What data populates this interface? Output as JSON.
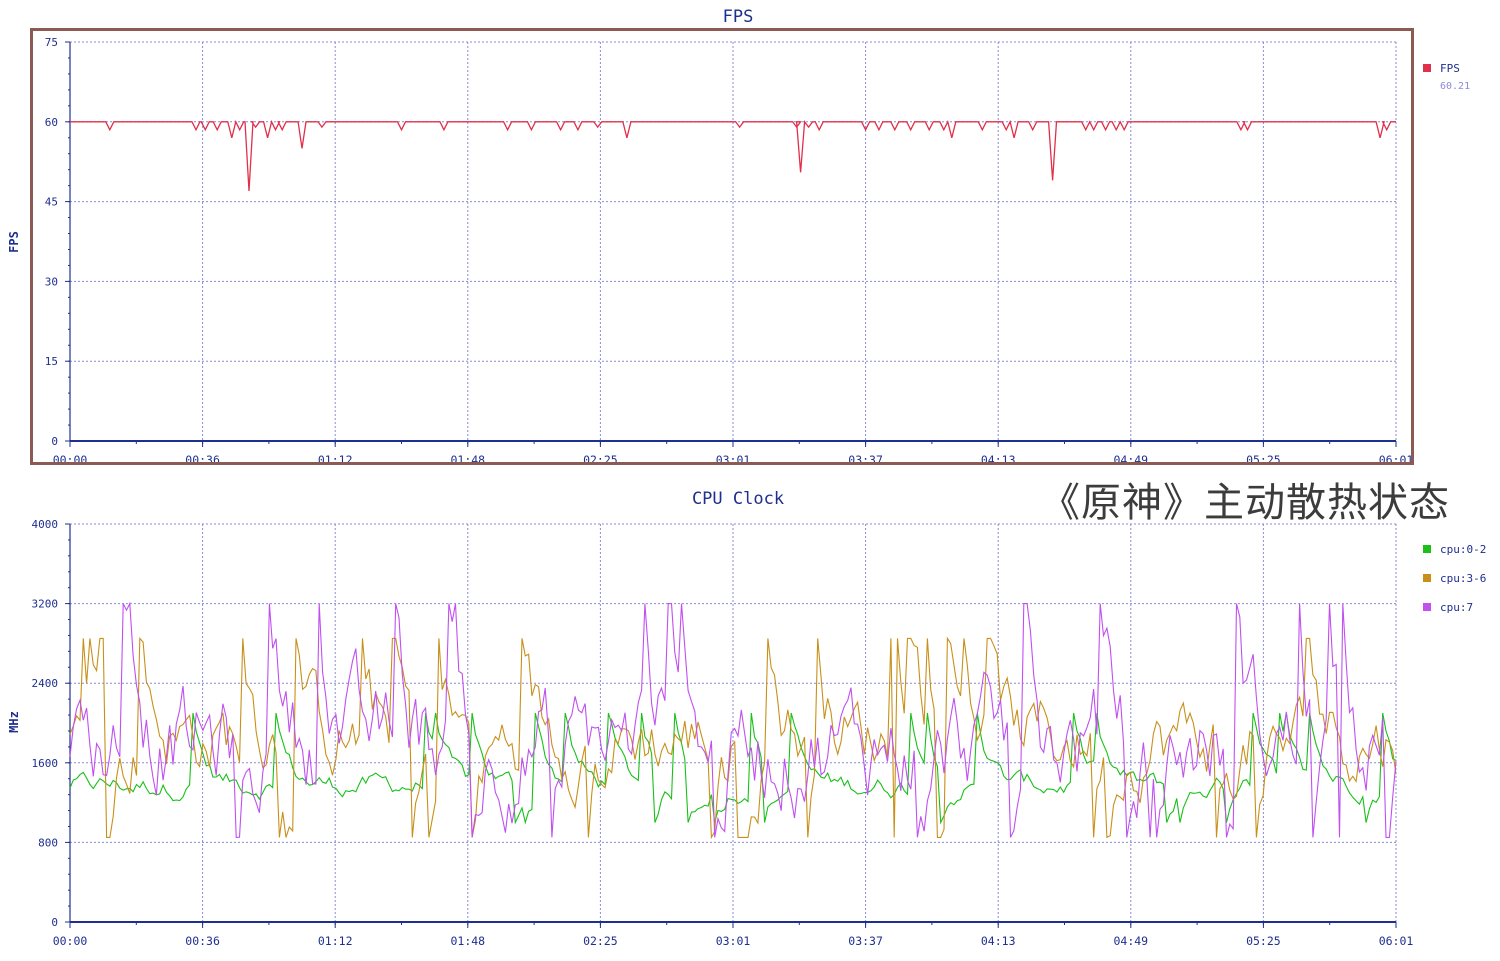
{
  "overlay_title": "《原神》主动散热状态",
  "colors": {
    "axis": "#1f2f8f",
    "grid": "#8a8ad8",
    "tick_text": "#1f2f8f",
    "title": "#1f2f8f",
    "frame": "#8b5a52"
  },
  "chart_data": [
    {
      "type": "line",
      "title": "FPS",
      "ylabel": "FPS",
      "ylim": [
        0,
        75
      ],
      "yticks": [
        "0",
        "15",
        "30",
        "45",
        "60",
        "75"
      ],
      "xticks": [
        "00:00",
        "00:36",
        "01:12",
        "01:48",
        "02:25",
        "03:01",
        "03:37",
        "04:13",
        "04:49",
        "05:25",
        "06:01"
      ],
      "grid": true,
      "legend": "right",
      "series": [
        {
          "name": "FPS",
          "legend_value": "60.21",
          "color": "#e0304a",
          "baseline": 60,
          "dips": [
            [
              0.03,
              58.5
            ],
            [
              0.095,
              58.5
            ],
            [
              0.102,
              58.5
            ],
            [
              0.111,
              58.5
            ],
            [
              0.122,
              57
            ],
            [
              0.128,
              58.5
            ],
            [
              0.135,
              47
            ],
            [
              0.14,
              59
            ],
            [
              0.149,
              57
            ],
            [
              0.155,
              58.5
            ],
            [
              0.16,
              58.5
            ],
            [
              0.175,
              55
            ],
            [
              0.19,
              59
            ],
            [
              0.25,
              58.5
            ],
            [
              0.282,
              58.5
            ],
            [
              0.33,
              58.5
            ],
            [
              0.348,
              58.5
            ],
            [
              0.37,
              58.5
            ],
            [
              0.383,
              58.5
            ],
            [
              0.398,
              59
            ],
            [
              0.42,
              57
            ],
            [
              0.505,
              59
            ],
            [
              0.548,
              59
            ],
            [
              0.551,
              50.5
            ],
            [
              0.557,
              59
            ],
            [
              0.565,
              58.5
            ],
            [
              0.6,
              58.5
            ],
            [
              0.61,
              58.5
            ],
            [
              0.622,
              58.5
            ],
            [
              0.634,
              58.5
            ],
            [
              0.648,
              58.5
            ],
            [
              0.659,
              58.5
            ],
            [
              0.665,
              57
            ],
            [
              0.688,
              58.5
            ],
            [
              0.706,
              58.5
            ],
            [
              0.712,
              57
            ],
            [
              0.726,
              58.5
            ],
            [
              0.741,
              49
            ],
            [
              0.766,
              58.5
            ],
            [
              0.772,
              58.5
            ],
            [
              0.781,
              58.5
            ],
            [
              0.789,
              58.5
            ],
            [
              0.795,
              58.5
            ],
            [
              0.883,
              58.5
            ],
            [
              0.888,
              58.5
            ],
            [
              0.988,
              57
            ],
            [
              0.993,
              58.5
            ]
          ]
        }
      ]
    },
    {
      "type": "line",
      "title": "CPU Clock",
      "ylabel": "MHz",
      "ylim": [
        0,
        4000
      ],
      "yticks": [
        "0",
        "800",
        "1600",
        "2400",
        "3200",
        "4000"
      ],
      "xticks": [
        "00:00",
        "00:36",
        "01:12",
        "01:48",
        "02:25",
        "03:01",
        "03:37",
        "04:13",
        "04:49",
        "05:25",
        "06:01"
      ],
      "grid": true,
      "legend": "right",
      "series": [
        {
          "name": "cpu:0-2",
          "color": "#18c018",
          "min": 1000,
          "max": 2100,
          "typical": [
            1250,
            1500
          ]
        },
        {
          "name": "cpu:3-6",
          "color": "#c8901a",
          "min": 850,
          "max": 2850,
          "typical": [
            1400,
            2300
          ]
        },
        {
          "name": "cpu:7",
          "color": "#c050f0",
          "min": 850,
          "max": 3200,
          "typical": [
            1200,
            2400
          ]
        }
      ]
    }
  ]
}
